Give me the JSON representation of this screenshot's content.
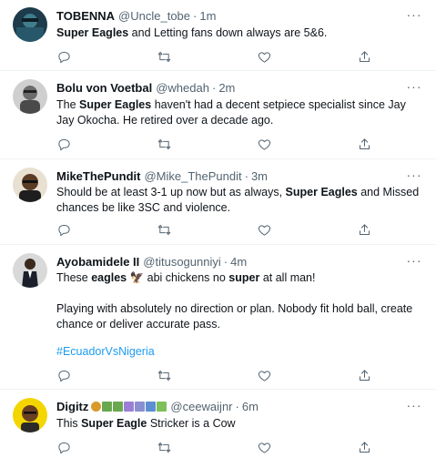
{
  "tweets": [
    {
      "name": "TOBENNA",
      "handle": "@Uncle_tobe",
      "sep": "·",
      "time": "1m",
      "text": [
        {
          "t": "Super Eagles",
          "b": true
        },
        {
          "t": " and Letting fans down always are 5&6."
        }
      ]
    },
    {
      "name": "Bolu von Voetbal",
      "handle": "@whedah",
      "sep": "·",
      "time": "2m",
      "text": [
        {
          "t": "The "
        },
        {
          "t": "Super Eagles",
          "b": true
        },
        {
          "t": " haven't had a decent setpiece specialist since Jay Jay Okocha. He retired over a decade ago."
        }
      ]
    },
    {
      "name": "MikeThePundit",
      "handle": "@Mike_ThePundit",
      "sep": "·",
      "time": "3m",
      "text": [
        {
          "t": "Should be at least 3-1 up now but as always, "
        },
        {
          "t": "Super Eagles",
          "b": true
        },
        {
          "t": " and Missed chances be like 3SC and violence."
        }
      ]
    },
    {
      "name": "Ayobamidele II",
      "handle": "@titusogunniyi",
      "sep": "·",
      "time": "4m",
      "line1": [
        {
          "t": "These "
        },
        {
          "t": "eagles",
          "b": true
        },
        {
          "t": " 🦅 abi chickens no "
        },
        {
          "t": "super",
          "b": true
        },
        {
          "t": " at all man!"
        }
      ],
      "line2": "Playing with absolutely no direction or plan. Nobody fit hold ball, create chance or deliver accurate pass.",
      "hashtag": "#EcuadorVsNigeria"
    },
    {
      "name": "Digitz",
      "handle": "@ceewaijnr",
      "sep": "·",
      "time": "6m",
      "text": [
        {
          "t": "This "
        },
        {
          "t": "Super Eagle",
          "b": true
        },
        {
          "t": " Stricker is a Cow"
        }
      ]
    }
  ],
  "colors": {
    "text": "#0f1419",
    "muted": "#536471",
    "link": "#1d9bf0",
    "divider": "#eff3f4"
  },
  "icons": [
    "reply-icon",
    "retweet-icon",
    "like-icon",
    "share-icon",
    "more-icon"
  ]
}
